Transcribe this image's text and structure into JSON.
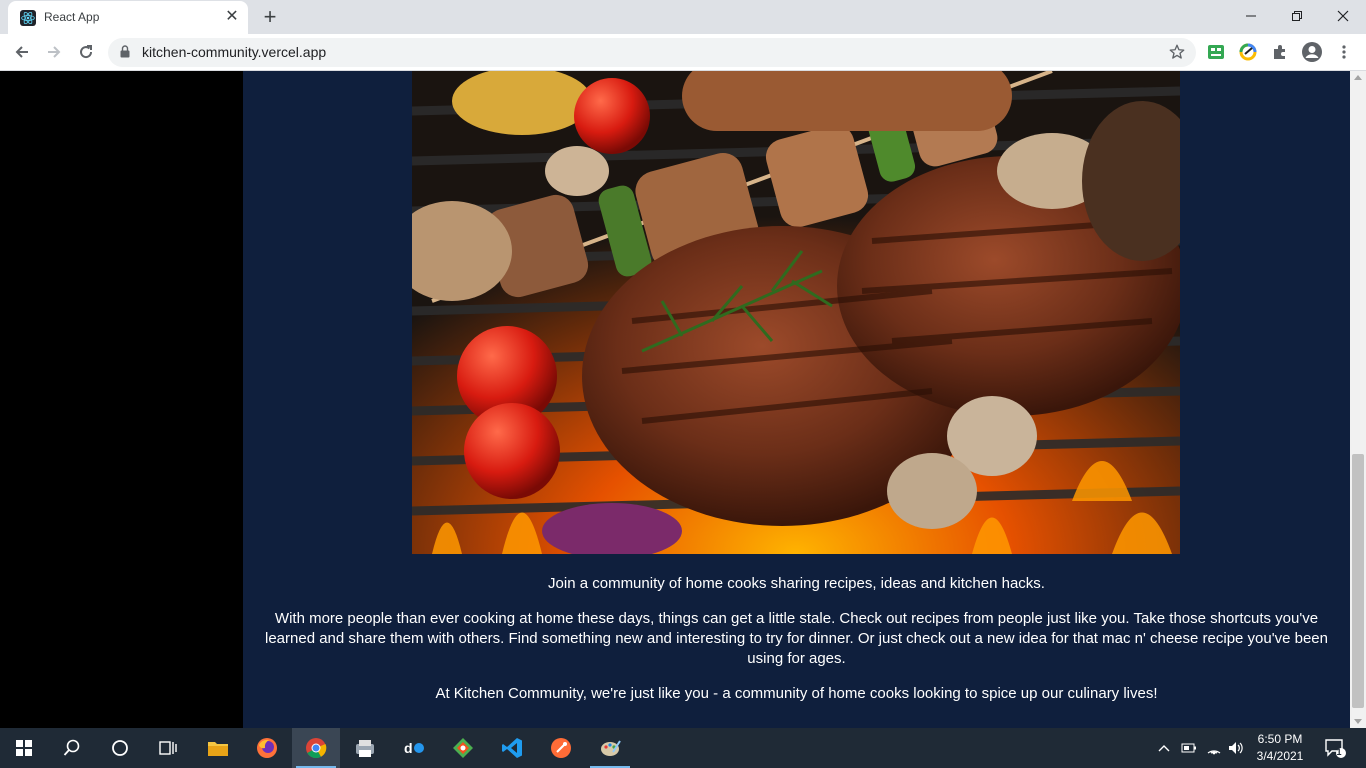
{
  "browser": {
    "tab_title": "React App",
    "url": "kitchen-community.vercel.app"
  },
  "page": {
    "hero_alt": "Grilled steaks, skewers, tomatoes and mushrooms on a flaming grill",
    "intro": "Join a community of home cooks sharing recipes, ideas and kitchen hacks.",
    "body": "With more people than ever cooking at home these days, things can get a little stale. Check out recipes from people just like you. Take those shortcuts you've learned and share them with others. Find something new and interesting to try for dinner. Or just check out a new idea for that mac n' cheese recipe you've been using for ages.",
    "closing": "At Kitchen Community, we're just like you - a community of home cooks looking to spice up our culinary lives!"
  },
  "taskbar": {
    "time": "6:50 PM",
    "date": "3/4/2021",
    "notification_count": "1"
  },
  "colors": {
    "page_background": "#0f1f3d",
    "sidebar_background": "#000000",
    "taskbar_background": "#1f2a36",
    "accent": "#76b9ed"
  }
}
